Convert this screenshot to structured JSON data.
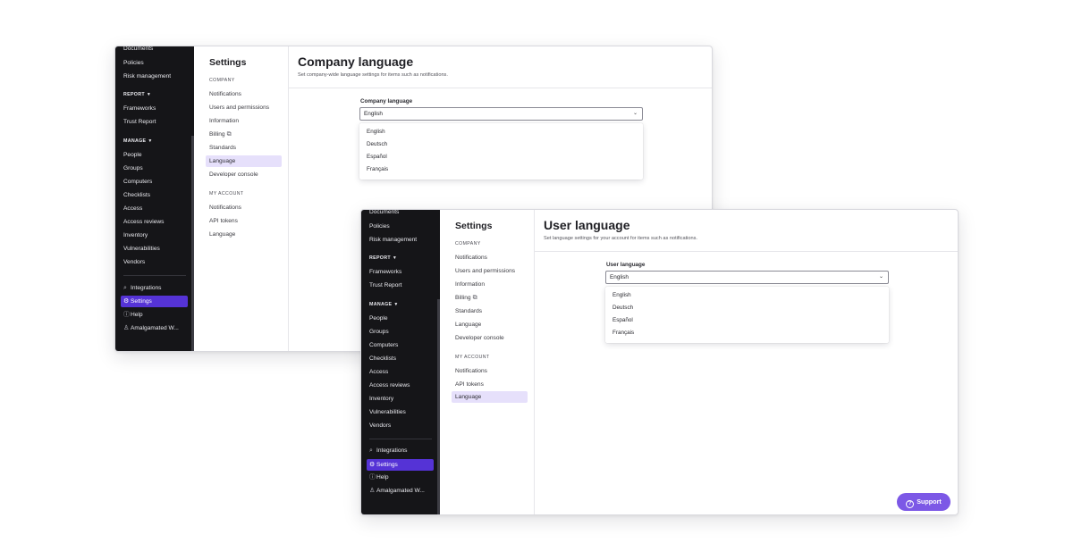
{
  "windows": [
    {
      "sidebar": {
        "cut_item": "Documents",
        "items_top": [
          "Policies",
          "Risk management"
        ],
        "report_head": "REPORT",
        "report_items": [
          "Frameworks",
          "Trust Report"
        ],
        "manage_head": "MANAGE",
        "manage_items": [
          "People",
          "Groups",
          "Computers",
          "Checklists",
          "Access",
          "Access reviews",
          "Inventory",
          "Vulnerabilities",
          "Vendors"
        ],
        "integrations": "Integrations",
        "settings": "Settings",
        "help": "Help",
        "account": "Amalgamated W..."
      },
      "settings_nav": {
        "title": "Settings",
        "company_head": "COMPANY",
        "company_items": [
          "Notifications",
          "Users and permissions",
          "Information",
          "Billing",
          "Standards",
          "Language",
          "Developer console"
        ],
        "account_head": "MY ACCOUNT",
        "account_items": [
          "Notifications",
          "API tokens",
          "Language"
        ]
      },
      "content": {
        "title": "Company language",
        "subtitle": "Set company-wide language settings for items such as notifications.",
        "field_label": "Company language",
        "selected": "English",
        "options": [
          "English",
          "Deutsch",
          "Español",
          "Français"
        ]
      }
    },
    {
      "sidebar": {
        "cut_item": "Documents",
        "items_top": [
          "Policies",
          "Risk management"
        ],
        "report_head": "REPORT",
        "report_items": [
          "Frameworks",
          "Trust Report"
        ],
        "manage_head": "MANAGE",
        "manage_items": [
          "People",
          "Groups",
          "Computers",
          "Checklists",
          "Access",
          "Access reviews",
          "Inventory",
          "Vulnerabilities",
          "Vendors"
        ],
        "integrations": "Integrations",
        "settings": "Settings",
        "help": "Help",
        "account": "Amalgamated W..."
      },
      "settings_nav": {
        "title": "Settings",
        "company_head": "COMPANY",
        "company_items": [
          "Notifications",
          "Users and permissions",
          "Information",
          "Billing",
          "Standards",
          "Language",
          "Developer console"
        ],
        "account_head": "MY ACCOUNT",
        "account_items": [
          "Notifications",
          "API tokens",
          "Language"
        ]
      },
      "content": {
        "title": "User language",
        "subtitle": "Set language settings for your account for items such as notifications.",
        "field_label": "User language",
        "selected": "English",
        "options": [
          "English",
          "Deutsch",
          "Español",
          "Français"
        ]
      },
      "support_label": "Support"
    }
  ],
  "icons": {
    "integrations": "search-icon",
    "settings": "gear-icon",
    "help": "help-circle-icon",
    "account": "user-icon",
    "billing": "external-link-icon",
    "dropdown": "chevron-down-icon"
  },
  "colors": {
    "sidebar_bg": "#151518",
    "active_nav": "#5533d6",
    "active_settings_item": "#e6e0fb",
    "support_button": "#7c58e6"
  }
}
